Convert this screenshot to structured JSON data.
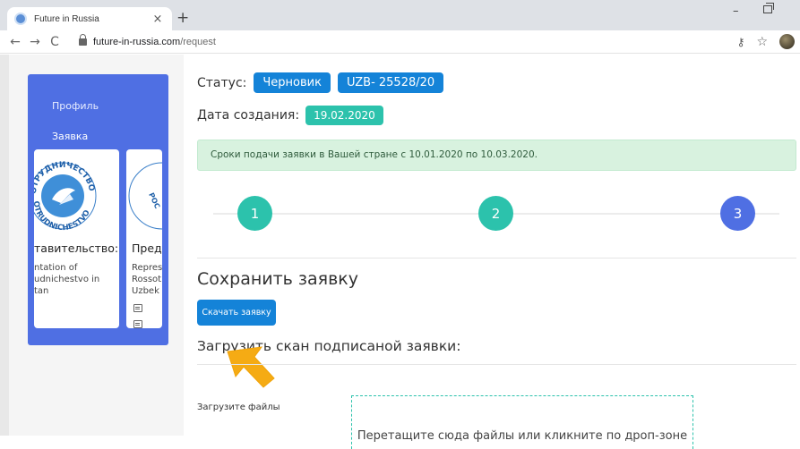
{
  "browser": {
    "tab_title": "Future in Russia",
    "tab_close": "×",
    "new_tab": "+",
    "url_domain": "future-in-russia.com",
    "url_path": "/request",
    "back": "←",
    "forward": "→",
    "reload": "C",
    "minimize": "–",
    "key_icon": "⚷",
    "star_icon": "☆"
  },
  "sidebar": {
    "items": [
      {
        "label": "Профиль"
      },
      {
        "label": "Заявка"
      }
    ],
    "cards": [
      {
        "title": "тавительство:",
        "text": [
          "ntation of",
          "udnichestvo in",
          "tan"
        ],
        "logo_text_top": "ОТРУДНИЧЕСТВО",
        "logo_text_bottom": "OTRUDNICHESTVO"
      },
      {
        "title": "Пред",
        "text": [
          "Repres",
          "Rossot",
          "Uzbek"
        ]
      }
    ]
  },
  "main": {
    "status_label": "Статус:",
    "status_value": "Черновик",
    "request_number": "UZB- 25528/20",
    "date_label": "Дата создания:",
    "date_value": "19.02.2020",
    "alert_text": "Сроки подачи заявки в Вашей стране с 10.01.2020 по 10.03.2020.",
    "steps": [
      "1",
      "2",
      "3"
    ],
    "save_heading": "Сохранить заявку",
    "download_button": "Скачать заявку",
    "upload_heading": "Загрузить скан подписаной заявки:",
    "files_label": "Загрузите файлы",
    "dropzone_text": "Перетащите сюда файлы или кликните по дроп-зоне"
  },
  "colors": {
    "sidebar": "#4f6fe3",
    "primary": "#1483d8",
    "teal": "#2cc2ac",
    "alert_bg": "#d8f2df",
    "arrow": "#f5ab14"
  }
}
